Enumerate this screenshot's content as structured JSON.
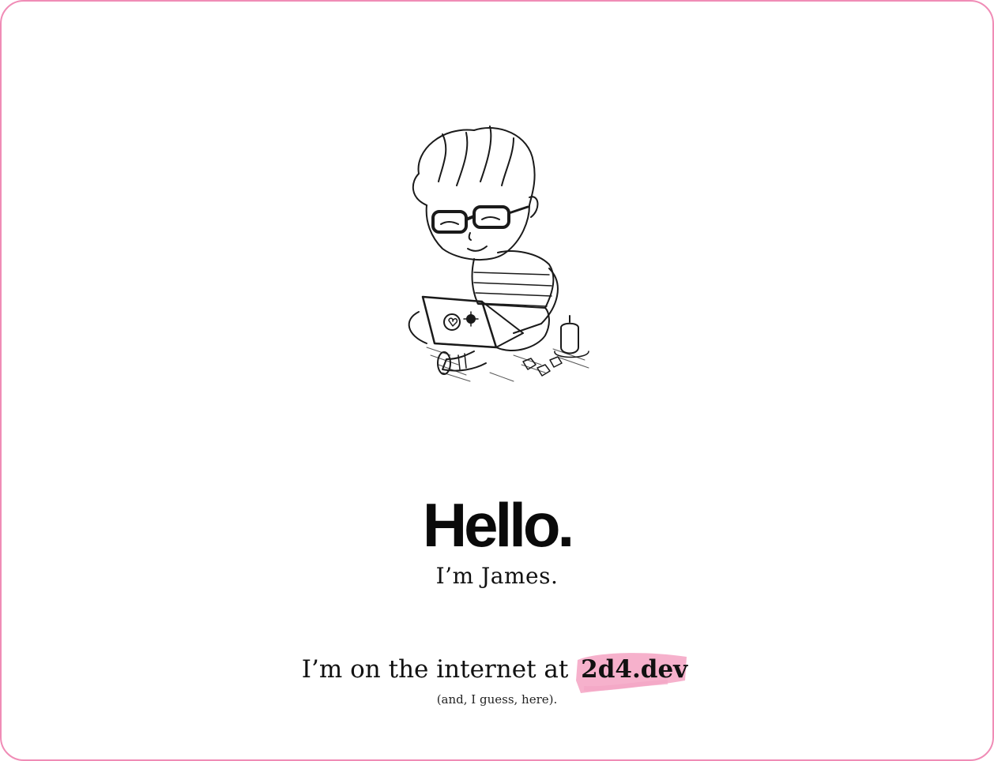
{
  "hero": {
    "illustration_icon": "boy-with-laptop-illustration",
    "greeting": "Hello.",
    "intro": "I’m James."
  },
  "internet": {
    "prefix": "I’m on the internet at ",
    "link_text": "2d4.dev",
    "aside": "(and, I guess, here)."
  },
  "colors": {
    "frame_border": "#f08cb6",
    "highlight": "#f4a3c3",
    "text": "#111111"
  }
}
